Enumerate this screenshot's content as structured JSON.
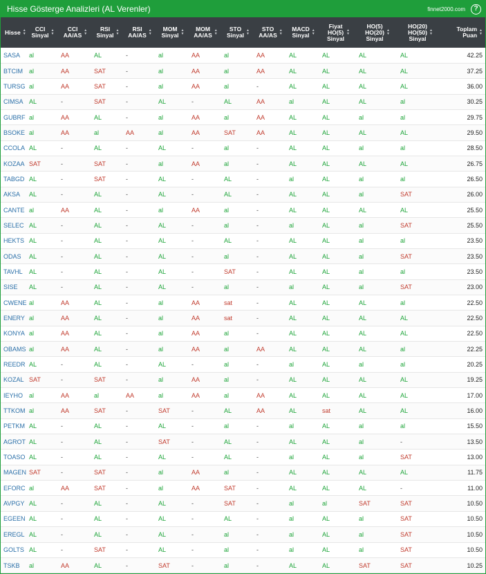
{
  "app": {
    "title": "Hisse Gösterge Analizleri (AL Verenler)",
    "site": "finnet2000.com",
    "help_icon": "question-circle-icon",
    "colors": {
      "header": "#1f9e3b",
      "table_head": "#3a3f44",
      "positive": "#1aa336",
      "negative": "#c0392b",
      "symbol": "#2a6fa8"
    }
  },
  "columns": [
    {
      "lines": [
        "Hisse"
      ]
    },
    {
      "lines": [
        "CCI",
        "Sinyal"
      ]
    },
    {
      "lines": [
        "CCI",
        "AA/AS"
      ]
    },
    {
      "lines": [
        "RSI",
        "Sinyal"
      ]
    },
    {
      "lines": [
        "RSI",
        "AA/AS"
      ]
    },
    {
      "lines": [
        "MOM",
        "Sinyal"
      ]
    },
    {
      "lines": [
        "MOM",
        "AA/AS"
      ]
    },
    {
      "lines": [
        "STO",
        "Sinyal"
      ]
    },
    {
      "lines": [
        "STO",
        "AA/AS"
      ]
    },
    {
      "lines": [
        "MACD",
        "Sinyal"
      ]
    },
    {
      "lines": [
        "Fiyat",
        "HO(5)",
        "Sinyal"
      ]
    },
    {
      "lines": [
        "HO(5)",
        "HO(20)",
        "Sinyal"
      ]
    },
    {
      "lines": [
        "HO(20)",
        "HO(50)",
        "Sinyal"
      ]
    },
    {
      "lines": [
        "Toplam",
        "Puan"
      ]
    }
  ],
  "rows": [
    [
      "SASA",
      "al",
      "AA",
      "AL",
      "-",
      "al",
      "AA",
      "al",
      "AA",
      "AL",
      "AL",
      "AL",
      "AL",
      "42.25"
    ],
    [
      "BTCIM",
      "al",
      "AA",
      "SAT",
      "-",
      "al",
      "AA",
      "al",
      "AA",
      "AL",
      "AL",
      "AL",
      "AL",
      "37.25"
    ],
    [
      "TURSG",
      "al",
      "AA",
      "SAT",
      "-",
      "al",
      "AA",
      "al",
      "-",
      "AL",
      "AL",
      "AL",
      "AL",
      "36.00"
    ],
    [
      "CIMSA",
      "AL",
      "-",
      "SAT",
      "-",
      "AL",
      "-",
      "AL",
      "AA",
      "al",
      "AL",
      "AL",
      "al",
      "30.25"
    ],
    [
      "GUBRF",
      "al",
      "AA",
      "AL",
      "-",
      "al",
      "AA",
      "al",
      "AA",
      "AL",
      "AL",
      "al",
      "al",
      "29.75"
    ],
    [
      "BSOKE",
      "al",
      "AA",
      "al",
      "AA",
      "al",
      "AA",
      "SAT",
      "AA",
      "AL",
      "AL",
      "AL",
      "AL",
      "29.50"
    ],
    [
      "CCOLA",
      "AL",
      "-",
      "AL",
      "-",
      "AL",
      "-",
      "al",
      "-",
      "AL",
      "AL",
      "al",
      "al",
      "28.50"
    ],
    [
      "KOZAA",
      "SAT",
      "-",
      "SAT",
      "-",
      "al",
      "AA",
      "al",
      "-",
      "AL",
      "AL",
      "AL",
      "AL",
      "26.75"
    ],
    [
      "TABGD",
      "AL",
      "-",
      "SAT",
      "-",
      "AL",
      "-",
      "AL",
      "-",
      "al",
      "AL",
      "al",
      "al",
      "26.50"
    ],
    [
      "AKSA",
      "AL",
      "-",
      "AL",
      "-",
      "AL",
      "-",
      "AL",
      "-",
      "AL",
      "AL",
      "al",
      "SAT",
      "26.00"
    ],
    [
      "CANTE",
      "al",
      "AA",
      "AL",
      "-",
      "al",
      "AA",
      "al",
      "-",
      "AL",
      "AL",
      "AL",
      "AL",
      "25.50"
    ],
    [
      "SELEC",
      "AL",
      "-",
      "AL",
      "-",
      "AL",
      "-",
      "al",
      "-",
      "al",
      "AL",
      "al",
      "SAT",
      "25.50"
    ],
    [
      "HEKTS",
      "AL",
      "-",
      "AL",
      "-",
      "AL",
      "-",
      "AL",
      "-",
      "AL",
      "AL",
      "al",
      "al",
      "23.50"
    ],
    [
      "ODAS",
      "AL",
      "-",
      "AL",
      "-",
      "AL",
      "-",
      "al",
      "-",
      "AL",
      "AL",
      "al",
      "SAT",
      "23.50"
    ],
    [
      "TAVHL",
      "AL",
      "-",
      "AL",
      "-",
      "AL",
      "-",
      "SAT",
      "-",
      "AL",
      "AL",
      "al",
      "al",
      "23.50"
    ],
    [
      "SISE",
      "AL",
      "-",
      "AL",
      "-",
      "AL",
      "-",
      "al",
      "-",
      "al",
      "AL",
      "al",
      "SAT",
      "23.00"
    ],
    [
      "CWENE",
      "al",
      "AA",
      "AL",
      "-",
      "al",
      "AA",
      "sat",
      "-",
      "AL",
      "AL",
      "AL",
      "al",
      "22.50"
    ],
    [
      "ENERY",
      "al",
      "AA",
      "AL",
      "-",
      "al",
      "AA",
      "sat",
      "-",
      "AL",
      "AL",
      "AL",
      "AL",
      "22.50"
    ],
    [
      "KONYA",
      "al",
      "AA",
      "AL",
      "-",
      "al",
      "AA",
      "al",
      "-",
      "AL",
      "AL",
      "AL",
      "AL",
      "22.50"
    ],
    [
      "OBAMS",
      "al",
      "AA",
      "AL",
      "-",
      "al",
      "AA",
      "al",
      "AA",
      "AL",
      "AL",
      "AL",
      "al",
      "22.25"
    ],
    [
      "REEDR",
      "AL",
      "-",
      "AL",
      "-",
      "AL",
      "-",
      "al",
      "-",
      "al",
      "AL",
      "al",
      "al",
      "20.25"
    ],
    [
      "KOZAL",
      "SAT",
      "-",
      "SAT",
      "-",
      "al",
      "AA",
      "al",
      "-",
      "AL",
      "AL",
      "AL",
      "AL",
      "19.25"
    ],
    [
      "IEYHO",
      "al",
      "AA",
      "al",
      "AA",
      "al",
      "AA",
      "al",
      "AA",
      "AL",
      "AL",
      "AL",
      "AL",
      "17.00"
    ],
    [
      "TTKOM",
      "al",
      "AA",
      "SAT",
      "-",
      "SAT",
      "-",
      "AL",
      "AA",
      "AL",
      "sat",
      "AL",
      "AL",
      "16.00"
    ],
    [
      "PETKM",
      "AL",
      "-",
      "AL",
      "-",
      "AL",
      "-",
      "al",
      "-",
      "al",
      "AL",
      "al",
      "al",
      "15.50"
    ],
    [
      "AGROT",
      "AL",
      "-",
      "AL",
      "-",
      "SAT",
      "-",
      "AL",
      "-",
      "AL",
      "AL",
      "al",
      "-",
      "13.50"
    ],
    [
      "TOASO",
      "AL",
      "-",
      "AL",
      "-",
      "AL",
      "-",
      "AL",
      "-",
      "al",
      "AL",
      "al",
      "SAT",
      "13.00"
    ],
    [
      "MAGEN",
      "SAT",
      "-",
      "SAT",
      "-",
      "al",
      "AA",
      "al",
      "-",
      "AL",
      "AL",
      "AL",
      "AL",
      "11.75"
    ],
    [
      "EFORC",
      "al",
      "AA",
      "SAT",
      "-",
      "al",
      "AA",
      "SAT",
      "-",
      "AL",
      "AL",
      "AL",
      "-",
      "11.00"
    ],
    [
      "AVPGY",
      "AL",
      "-",
      "AL",
      "-",
      "AL",
      "-",
      "SAT",
      "-",
      "al",
      "al",
      "SAT",
      "SAT",
      "10.50"
    ],
    [
      "EGEEN",
      "AL",
      "-",
      "AL",
      "-",
      "AL",
      "-",
      "AL",
      "-",
      "al",
      "AL",
      "al",
      "SAT",
      "10.50"
    ],
    [
      "EREGL",
      "AL",
      "-",
      "AL",
      "-",
      "AL",
      "-",
      "al",
      "-",
      "al",
      "AL",
      "al",
      "SAT",
      "10.50"
    ],
    [
      "GOLTS",
      "AL",
      "-",
      "SAT",
      "-",
      "AL",
      "-",
      "al",
      "-",
      "al",
      "AL",
      "al",
      "SAT",
      "10.50"
    ],
    [
      "TSKB",
      "al",
      "AA",
      "AL",
      "-",
      "SAT",
      "-",
      "al",
      "-",
      "AL",
      "AL",
      "SAT",
      "SAT",
      "10.25"
    ]
  ]
}
